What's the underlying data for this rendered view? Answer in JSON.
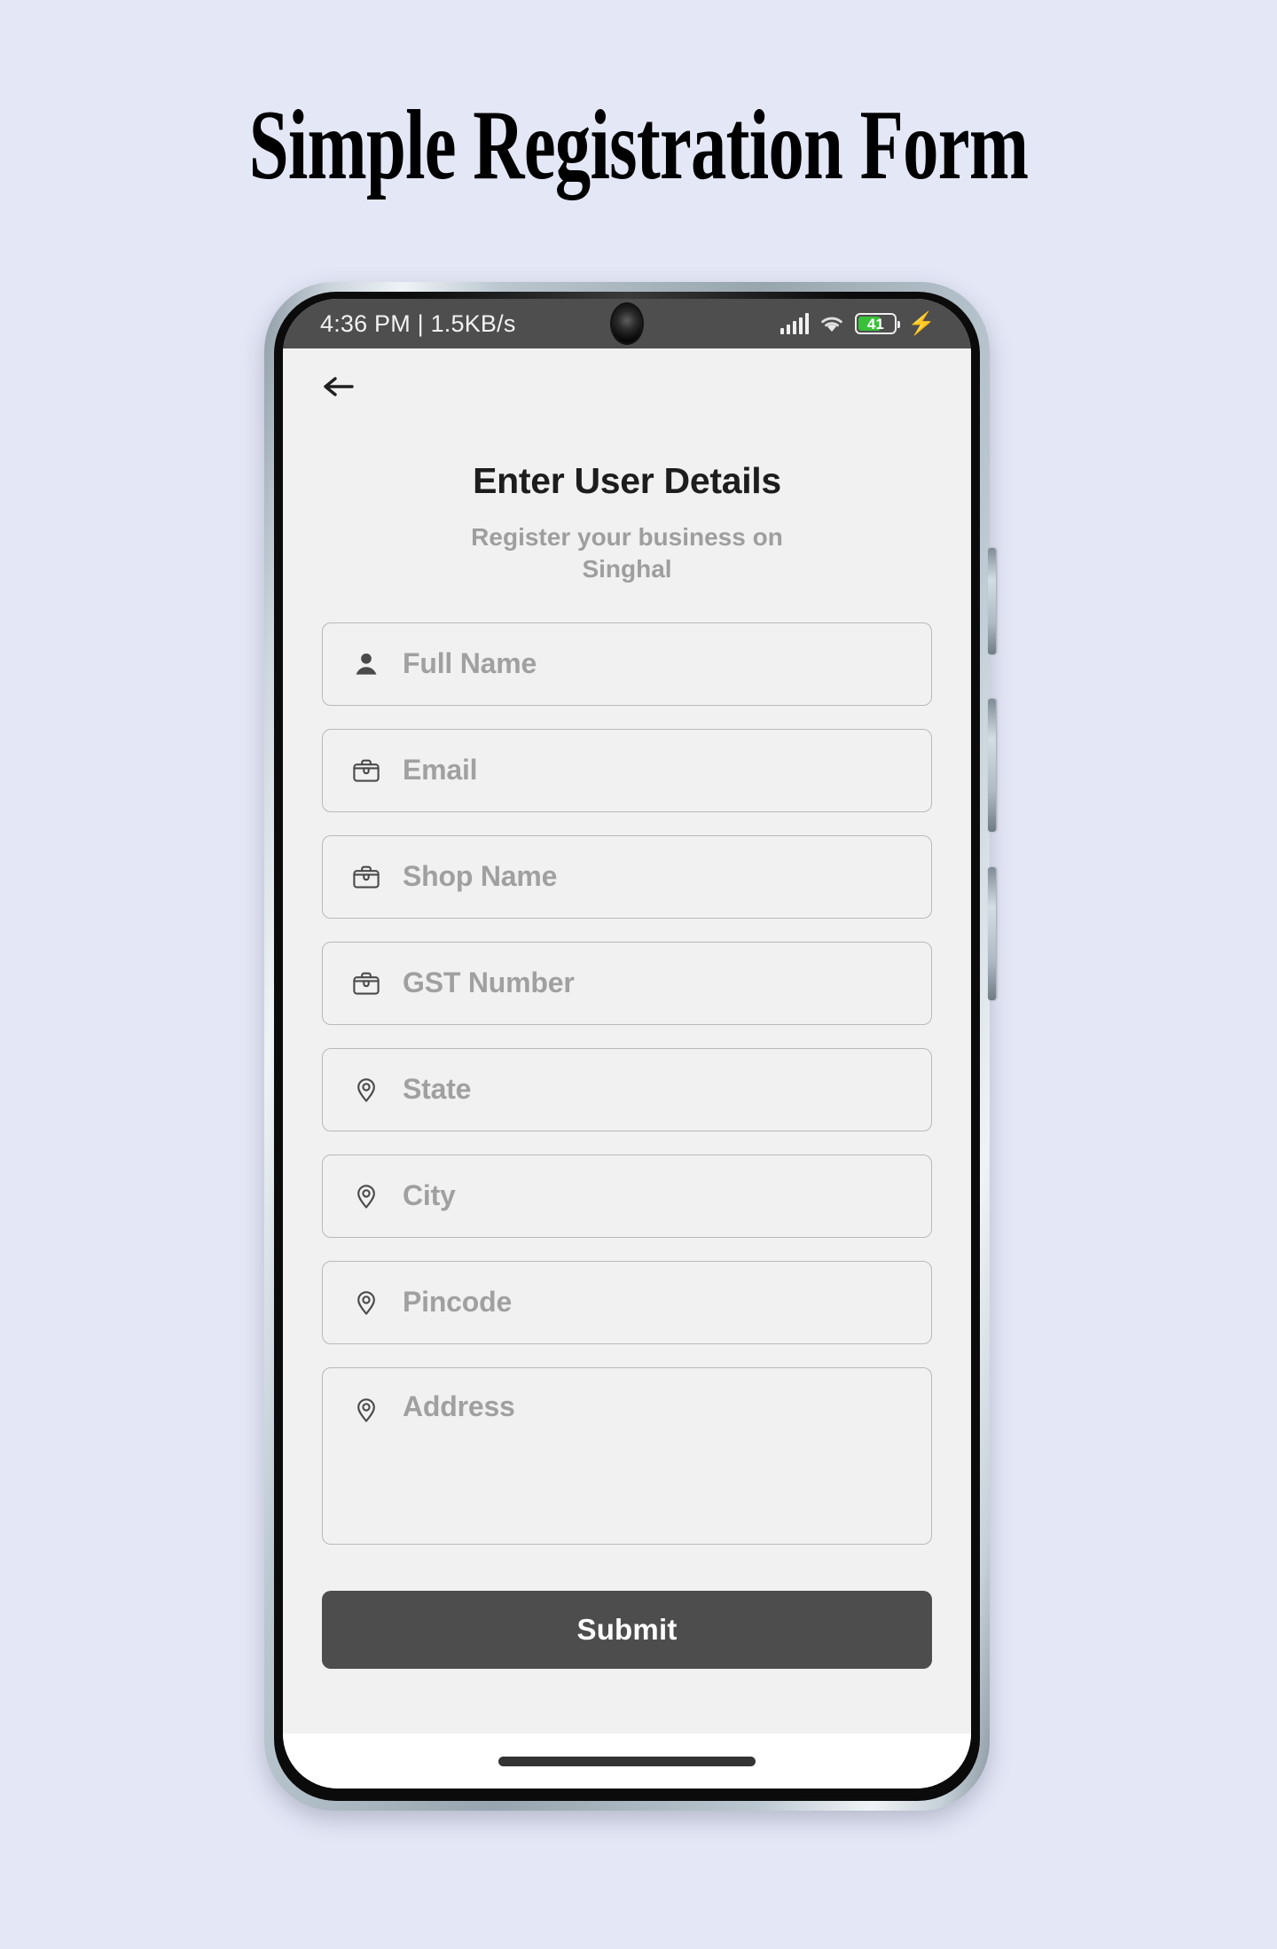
{
  "page": {
    "title": "Simple Registration Form",
    "background_color": "#e4e7f6"
  },
  "phone": {
    "frame_color": "#a8b5bf",
    "status_bar": {
      "background_color": "#4e4e4e",
      "left_text": "4:36 PM | 1.5KB/s",
      "icons": {
        "signal": "signal-bars-icon",
        "wifi": "wifi-icon",
        "battery": "battery-icon",
        "charging": "charging-bolt-icon"
      },
      "battery_level": "41",
      "battery_fill_color": "#38c039",
      "camera": "front-camera-punch-hole"
    },
    "home_indicator": "home-indicator-bar"
  },
  "app": {
    "background_color": "#f1f1f1",
    "back_icon": "back-arrow-icon",
    "title": "Enter User Details",
    "subtitle": "Register your business on Singhal",
    "fields": [
      {
        "name": "full-name",
        "placeholder": "Full Name",
        "icon": "person-filled-icon",
        "multiline": false
      },
      {
        "name": "email",
        "placeholder": "Email",
        "icon": "briefcase-icon",
        "multiline": false
      },
      {
        "name": "shop-name",
        "placeholder": "Shop Name",
        "icon": "briefcase-icon",
        "multiline": false
      },
      {
        "name": "gst-number",
        "placeholder": "GST Number",
        "icon": "briefcase-icon",
        "multiline": false
      },
      {
        "name": "state",
        "placeholder": "State",
        "icon": "location-pin-icon",
        "multiline": false
      },
      {
        "name": "city",
        "placeholder": "City",
        "icon": "location-pin-icon",
        "multiline": false
      },
      {
        "name": "pincode",
        "placeholder": "Pincode",
        "icon": "location-pin-icon",
        "multiline": false
      },
      {
        "name": "address",
        "placeholder": "Address",
        "icon": "location-pin-icon",
        "multiline": true
      }
    ],
    "submit": {
      "label": "Submit",
      "background_color": "#4d4d4d",
      "text_color": "#ffffff"
    }
  }
}
